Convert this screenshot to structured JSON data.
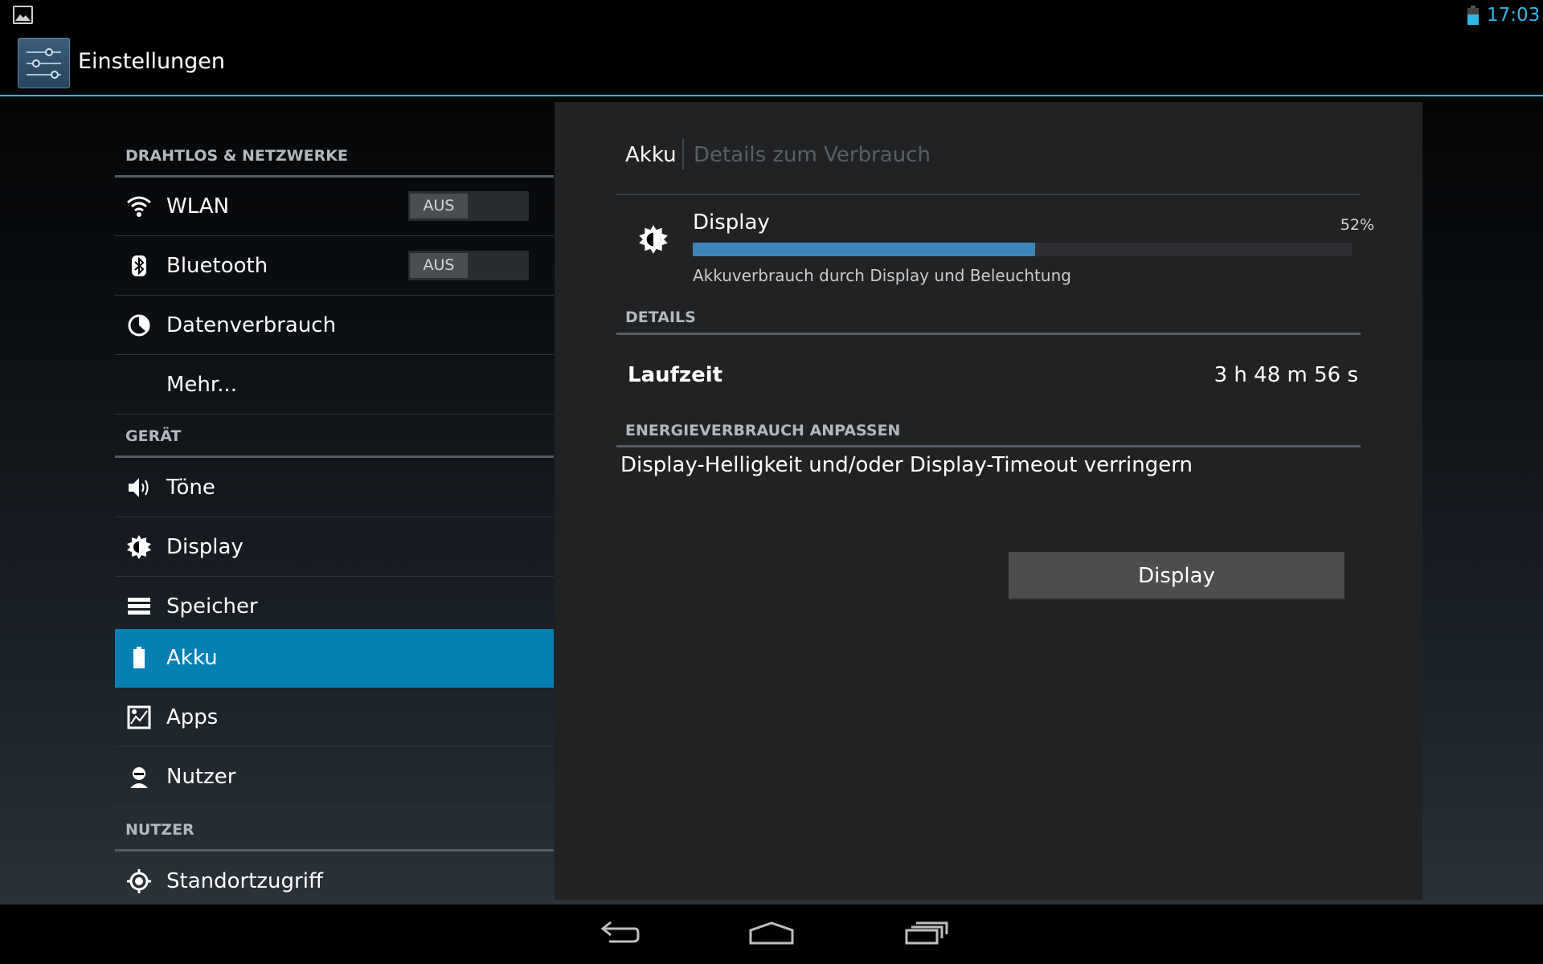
{
  "status_bar": {
    "time": "17:03",
    "left_icon": "gallery-icon",
    "right_icon": "battery-icon",
    "accent_color": "#33b5e5"
  },
  "action_bar": {
    "app_icon": "settings-sliders-icon",
    "title": "Einstellungen"
  },
  "sidebar": {
    "sections": [
      {
        "header": "DRAHTLOS & NETZWERKE",
        "items": [
          {
            "label": "WLAN",
            "icon": "wifi-icon",
            "toggle": "AUS"
          },
          {
            "label": "Bluetooth",
            "icon": "bluetooth-icon",
            "toggle": "AUS"
          },
          {
            "label": "Datenverbrauch",
            "icon": "data-usage-icon"
          },
          {
            "label": "Mehr..."
          }
        ]
      },
      {
        "header": "GERÄT",
        "items": [
          {
            "label": "Töne",
            "icon": "speaker-icon"
          },
          {
            "label": "Display",
            "icon": "brightness-icon"
          },
          {
            "label": "Speicher",
            "icon": "storage-icon"
          },
          {
            "label": "Akku",
            "icon": "battery-icon",
            "selected": true
          },
          {
            "label": "Apps",
            "icon": "apps-icon"
          },
          {
            "label": "Nutzer",
            "icon": "user-icon"
          }
        ]
      },
      {
        "header": "NUTZER",
        "items": [
          {
            "label": "Standortzugriff",
            "icon": "location-icon"
          }
        ]
      }
    ],
    "selected_color": "#0680b3"
  },
  "detail": {
    "breadcrumb_main": "Akku",
    "breadcrumb_sub": "Details zum Verbrauch",
    "usage": {
      "icon": "brightness-icon",
      "title": "Display",
      "percent_label": "52%",
      "percent": 52,
      "description": "Akkuverbrauch durch Display und Beleuchtung",
      "bar_color": "#3d84b8"
    },
    "details_header": "DETAILS",
    "runtime_label": "Laufzeit",
    "runtime_value": "3 h 48 m 56 s",
    "adjust_header": "ENERGIEVERBRAUCH ANPASSEN",
    "adjust_tip": "Display-Helligkeit und/oder Display-Timeout verringern",
    "button_label": "Display"
  },
  "nav_bar": {
    "buttons": [
      "back-icon",
      "home-icon",
      "recent-apps-icon"
    ]
  }
}
